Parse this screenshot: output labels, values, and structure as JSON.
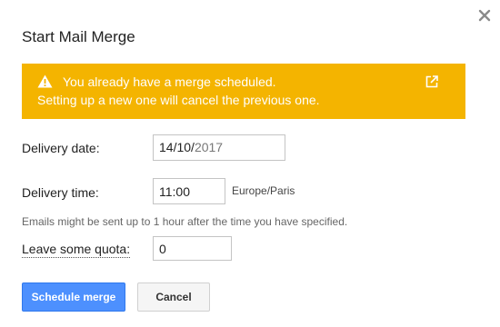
{
  "dialog": {
    "title": "Start Mail Merge"
  },
  "banner": {
    "line1": "You already have a merge scheduled.",
    "line2": "Setting up a new one will cancel the previous one.",
    "background_color": "#f4b400",
    "icon": "warning-icon",
    "action_icon": "open-in-new-icon"
  },
  "form": {
    "delivery_date": {
      "label": "Delivery date:",
      "day_month": "14/10/",
      "year": "2017"
    },
    "delivery_time": {
      "label": "Delivery time:",
      "value": "11:00",
      "timezone": "Europe/Paris"
    },
    "hint": "Emails might be sent up to 1 hour after the time you have specified.",
    "quota": {
      "label": "Leave some quota:",
      "value": "0"
    }
  },
  "buttons": {
    "primary_label": "Schedule merge",
    "secondary_label": "Cancel",
    "primary_color": "#4d90fe"
  },
  "icons": {
    "close": "close-icon"
  }
}
